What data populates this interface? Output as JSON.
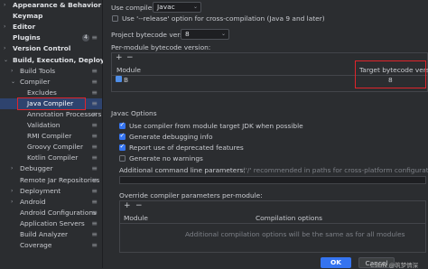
{
  "sidebar": {
    "items": [
      {
        "label": "Appearance & Behavior",
        "arrow": "›",
        "bold": true
      },
      {
        "label": "Keymap",
        "arrow": "",
        "bold": true
      },
      {
        "label": "Editor",
        "arrow": "›",
        "bold": true
      },
      {
        "label": "Plugins",
        "arrow": "",
        "bold": true,
        "badge": "4"
      },
      {
        "label": "Version Control",
        "arrow": "›",
        "bold": true
      },
      {
        "label": "Build, Execution, Deployment",
        "arrow": "⌄",
        "bold": true
      },
      {
        "label": "Build Tools",
        "arrow": "›"
      },
      {
        "label": "Compiler",
        "arrow": "⌄"
      },
      {
        "label": "Excludes",
        "arrow": ""
      },
      {
        "label": "Java Compiler",
        "arrow": "",
        "selected": true
      },
      {
        "label": "Annotation Processors",
        "arrow": ""
      },
      {
        "label": "Validation",
        "arrow": ""
      },
      {
        "label": "RMI Compiler",
        "arrow": ""
      },
      {
        "label": "Groovy Compiler",
        "arrow": ""
      },
      {
        "label": "Kotlin Compiler",
        "arrow": ""
      },
      {
        "label": "Debugger",
        "arrow": "›"
      },
      {
        "label": "Remote Jar Repositories",
        "arrow": ""
      },
      {
        "label": "Deployment",
        "arrow": "›"
      },
      {
        "label": "Android",
        "arrow": "›"
      },
      {
        "label": "Android Configurations",
        "arrow": ""
      },
      {
        "label": "Application Servers",
        "arrow": ""
      },
      {
        "label": "Build Analyzer",
        "arrow": ""
      },
      {
        "label": "Coverage",
        "arrow": ""
      }
    ]
  },
  "main": {
    "use_compiler_label": "Use compiler:",
    "compiler_value": "Javac",
    "release_option_label": "Use '--release' option for cross-compilation (Java 9 and later)",
    "project_bytecode_label": "Project bytecode version:",
    "project_bytecode_value": "8",
    "per_module_label": "Per-module bytecode version:",
    "add_btn": "+",
    "remove_btn": "−",
    "module_table": {
      "col_module": "Module",
      "col_target": "Target bytecode version",
      "rows": [
        {
          "module": "B",
          "target": "8"
        }
      ]
    },
    "javac_options_label": "Javac Options",
    "options": [
      {
        "label": "Use compiler from module target JDK when possible",
        "checked": true
      },
      {
        "label": "Generate debugging info",
        "checked": true
      },
      {
        "label": "Report use of deprecated features",
        "checked": true
      },
      {
        "label": "Generate no warnings",
        "checked": false
      }
    ],
    "additional_params_label": "Additional command line parameters:",
    "additional_params_hint": "('/' recommended in paths for cross-platform configurations)",
    "override_label": "Override compiler parameters per-module:",
    "override_table": {
      "col_module": "Module",
      "col_options": "Compilation options",
      "empty_text": "Additional compilation options will be the same as for all modules"
    },
    "ok_label": "OK",
    "cancel_label": "Cancel"
  },
  "watermark": "CSDN @筑梦情深"
}
